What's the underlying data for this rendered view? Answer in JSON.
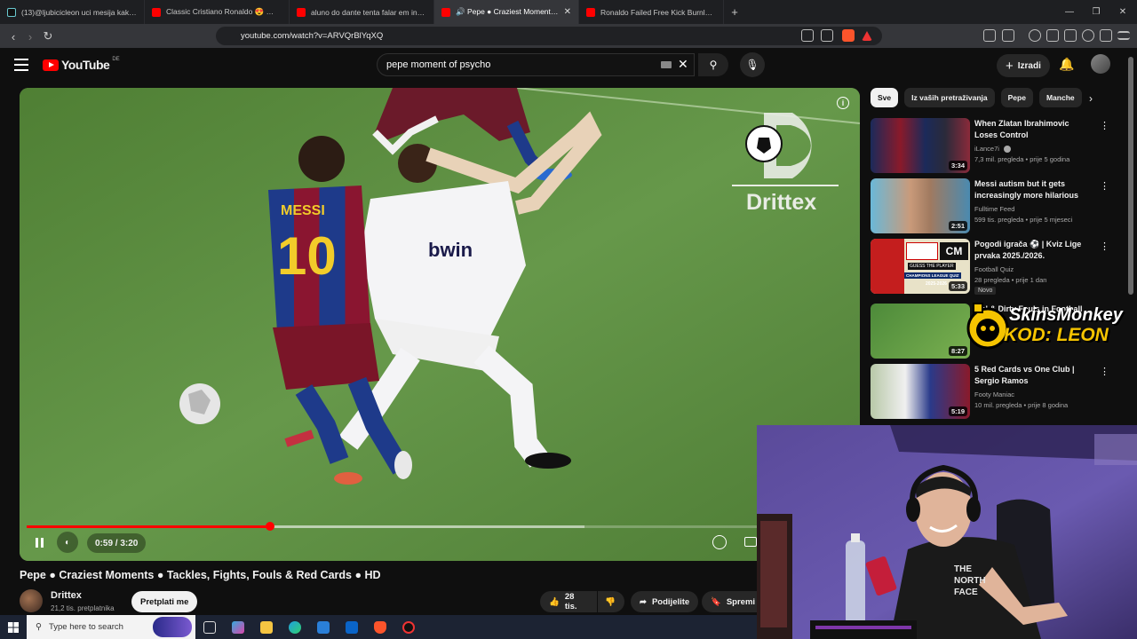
{
  "browser": {
    "tabs": [
      {
        "title": "(13)@ljubicicleon uci mesija kako da",
        "favicon": "tiktok",
        "active": false
      },
      {
        "title": "Classic Cristiano Ronaldo 😍 👈 - Yo",
        "favicon": "youtube",
        "active": false
      },
      {
        "title": "aluno do dante tenta falar em inglês",
        "favicon": "youtube",
        "active": false
      },
      {
        "title": "🔊 Pepe ● Craziest Moments ● T",
        "favicon": "youtube",
        "active": true
      },
      {
        "title": "Ronaldo Failed Free Kick Burnley - Yo",
        "favicon": "youtube",
        "active": false
      }
    ],
    "new_tab": "+",
    "url": "youtube.com/watch?v=ARVQrBlYqXQ"
  },
  "masthead": {
    "logo_text": "YouTube",
    "country_code": "DE",
    "search_value": "pepe moment of psycho",
    "create_label": "Izradi"
  },
  "player": {
    "watermark": "Drittex",
    "shirt_name": "MESSI",
    "shirt_number": "10",
    "sponsor_text": "bwin",
    "time_display": "0:59 / 3:20",
    "progress_fraction": 0.295,
    "buffer_fraction": 0.675
  },
  "video": {
    "title": "Pepe ● Craziest Moments ● Tackles, Fights, Fouls & Red Cards ● HD",
    "channel": "Drittex",
    "subscribers": "21,2 tis. pretplatnika",
    "subscribe_label": "Pretplati me",
    "likes": "28 tis.",
    "share_label": "Podijelite",
    "save_label": "Spremi"
  },
  "sidebar": {
    "chips": [
      "Sve",
      "Iz vaših pretraživanja",
      "Pepe",
      "Manche"
    ],
    "recommendations": [
      {
        "title": "When Zlatan Ibrahimovic Loses Control",
        "channel": "iLance7i",
        "meta": "7,3 mil. pregleda • prije 5 godina",
        "duration": "3:34",
        "verified": true
      },
      {
        "title": "Messi autism but it gets increasingly more hilarious",
        "channel": "Fulltime Feed",
        "meta": "599 tis. pregleda • prije 5 mjeseci",
        "duration": "2:51"
      },
      {
        "title": "Pogodi igrača ⚽ | Kviz Lige prvaka 2025./2026.",
        "channel": "Football Quiz",
        "meta": "28 pregleda • prije 1 dan",
        "duration": "5:33",
        "badge": "Novo",
        "thumb_text": [
          "CM",
          "GUESS THE PLAYER",
          "CHAMPIONS LEAGUE QUIZ",
          "2025-2026"
        ]
      },
      {
        "title": "...al & Dirty Fouls in Football",
        "channel": "",
        "meta": "",
        "duration": "8:27"
      },
      {
        "title": "5 Red Cards vs One Club | Sergio Ramos",
        "channel": "Footy Maniac",
        "meta": "10 mil. pregleda • prije 8 godina",
        "duration": "5:19"
      }
    ]
  },
  "overlay": {
    "sponsor_name": "SkinsMonkey",
    "sponsor_code": "KOD: LEON",
    "webcam_shirt_text": [
      "THE",
      "NORTH",
      "FACE"
    ]
  },
  "taskbar": {
    "search_placeholder": "Type here to search"
  }
}
